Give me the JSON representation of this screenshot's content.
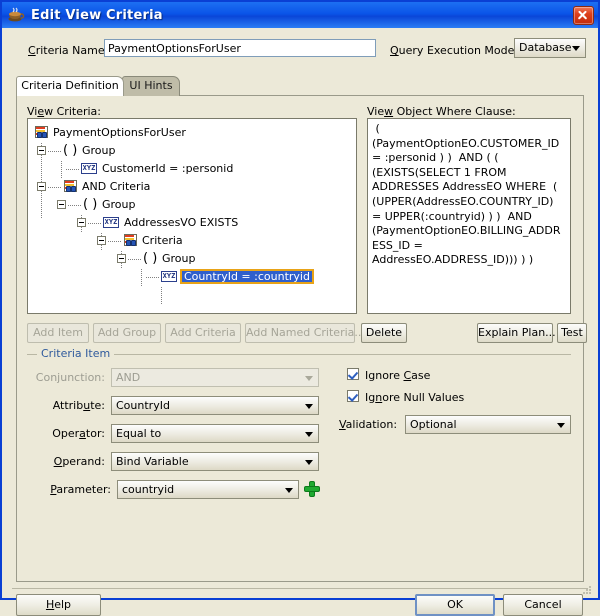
{
  "window": {
    "title": "Edit View Criteria",
    "app_icon": "java-coffee-cup-icon",
    "close_icon": "close-icon"
  },
  "header": {
    "criteria_name_label": "Criteria Name:",
    "criteria_name_value": "PaymentOptionsForUser",
    "query_execution_mode_label": "Query Execution Mode:",
    "query_execution_mode_value": "Database"
  },
  "tabs": [
    {
      "label": "Criteria Definition",
      "active": true
    },
    {
      "label": "UI Hints",
      "active": false
    }
  ],
  "view_criteria": {
    "label": "View Criteria:",
    "nodes": [
      {
        "label": "PaymentOptionsForUser",
        "icon": "view-object-icon",
        "depth": 0,
        "expander": false,
        "selected": false
      },
      {
        "label": "Group",
        "icon": "group-parens-icon",
        "depth": 1,
        "expander": true,
        "selected": false
      },
      {
        "label": "CustomerId = :personid",
        "icon": "attribute-xyz-icon",
        "depth": 2,
        "expander": false,
        "selected": false
      },
      {
        "label": "AND Criteria",
        "icon": "view-object-icon",
        "depth": 1,
        "expander": true,
        "selected": false
      },
      {
        "label": "Group",
        "icon": "group-parens-icon",
        "depth": 2,
        "expander": true,
        "selected": false
      },
      {
        "label": "AddressesVO EXISTS",
        "icon": "attribute-xyz-icon",
        "depth": 3,
        "expander": true,
        "selected": false
      },
      {
        "label": "Criteria",
        "icon": "view-object-icon",
        "depth": 4,
        "expander": true,
        "selected": false
      },
      {
        "label": "Group",
        "icon": "group-parens-icon",
        "depth": 5,
        "expander": true,
        "selected": false
      },
      {
        "label": "CountryId = :countryid",
        "icon": "attribute-xyz-icon",
        "depth": 6,
        "expander": false,
        "selected": true
      }
    ]
  },
  "where_clause": {
    "label": "View Object Where Clause:",
    "text": " ( (PaymentOptionEO.CUSTOMER_ID = :personid ) )  AND ( ( (EXISTS(SELECT 1 FROM ADDRESSES AddressEO WHERE  ( (UPPER(AddressEO.COUNTRY_ID) = UPPER(:countryid) ) )  AND (PaymentOptionEO.BILLING_ADDRESS_ID = AddressEO.ADDRESS_ID))) ) )"
  },
  "tree_buttons": [
    {
      "label": "Add Item",
      "enabled": false
    },
    {
      "label": "Add Group",
      "enabled": false
    },
    {
      "label": "Add Criteria",
      "enabled": false
    },
    {
      "label": "Add Named Criteria...",
      "enabled": false
    },
    {
      "label": "Delete",
      "enabled": true
    },
    {
      "label": "Explain Plan...",
      "enabled": true
    },
    {
      "label": "Test",
      "enabled": true
    }
  ],
  "criteria_item": {
    "group_title": "Criteria Item",
    "conjunction_label": "Conjunction:",
    "conjunction_value": "AND",
    "conjunction_enabled": false,
    "attribute_label": "Attribute:",
    "attribute_value": "CountryId",
    "operator_label": "Operator:",
    "operator_value": "Equal to",
    "operand_label": "Operand:",
    "operand_value": "Bind Variable",
    "parameter_label": "Parameter:",
    "parameter_value": "countryid",
    "add_parameter_icon": "green-plus-icon",
    "ignore_case_label": "Ignore Case",
    "ignore_case_checked": true,
    "ignore_null_values_label": "Ignore Null Values",
    "ignore_null_values_checked": true,
    "validation_label": "Validation:",
    "validation_value": "Optional"
  },
  "footer": {
    "help_label": "Help",
    "ok_label": "OK",
    "cancel_label": "Cancel"
  },
  "colors": {
    "titlebar_blue": "#0a54e8",
    "dialog_face": "#ece9d8",
    "selection_blue": "#2f5fcc",
    "selection_border_orange": "#e8a317",
    "group_title_blue": "#2f5a9c",
    "inactive_tab": "#bfbca8"
  }
}
